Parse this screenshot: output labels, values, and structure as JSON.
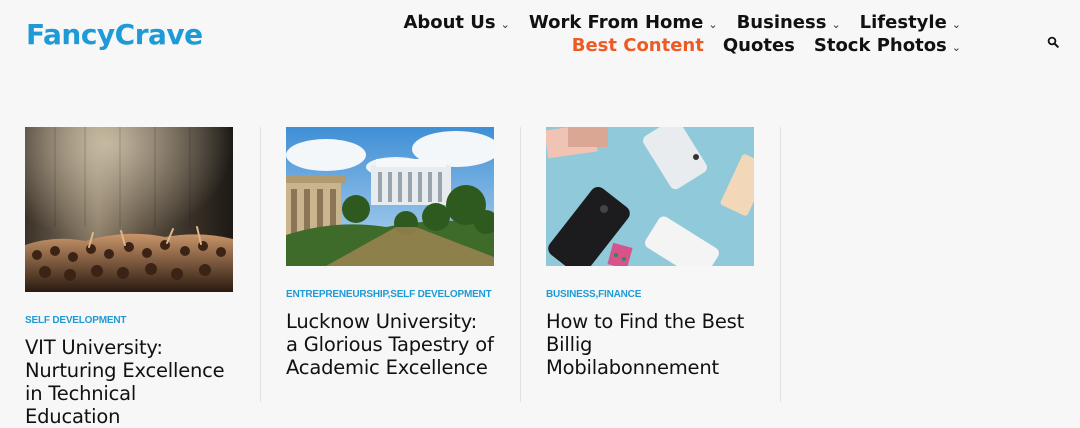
{
  "brand": {
    "logo_text": "FancyCrave",
    "color": "#1e9ad6"
  },
  "nav": {
    "items": [
      {
        "label": "About Us",
        "has_dropdown": true,
        "name": "nav-about-us"
      },
      {
        "label": "Work From Home",
        "has_dropdown": true,
        "name": "nav-work-from-home"
      },
      {
        "label": "Business",
        "has_dropdown": true,
        "name": "nav-business"
      },
      {
        "label": "Lifestyle",
        "has_dropdown": true,
        "name": "nav-lifestyle"
      },
      {
        "label": "Best Content",
        "has_dropdown": false,
        "name": "nav-best-content",
        "active": true
      },
      {
        "label": "Quotes",
        "has_dropdown": false,
        "name": "nav-quotes"
      },
      {
        "label": "Stock Photos",
        "has_dropdown": true,
        "name": "nav-stock-photos"
      }
    ],
    "caret_glyph": "⌄",
    "active_color": "#ee5a24"
  },
  "header": {
    "search_icon": "search-icon"
  },
  "posts": [
    {
      "categories": [
        "SELF DEVELOPMENT"
      ],
      "title": "VIT University: Nurturing Excellence in Technical Education",
      "image": "concert-crowd-stage-photo"
    },
    {
      "categories": [
        "ENTREPRENEURSHIP",
        "SELF DEVELOPMENT"
      ],
      "title": "Lucknow University: a Glorious Tapestry of Academic Excellence",
      "image": "university-building-photo"
    },
    {
      "categories": [
        "BUSINESS",
        "FINANCE"
      ],
      "title": "How to Find the Best Billig Mobilabonnement",
      "image": "smartphones-on-table-photo"
    }
  ]
}
